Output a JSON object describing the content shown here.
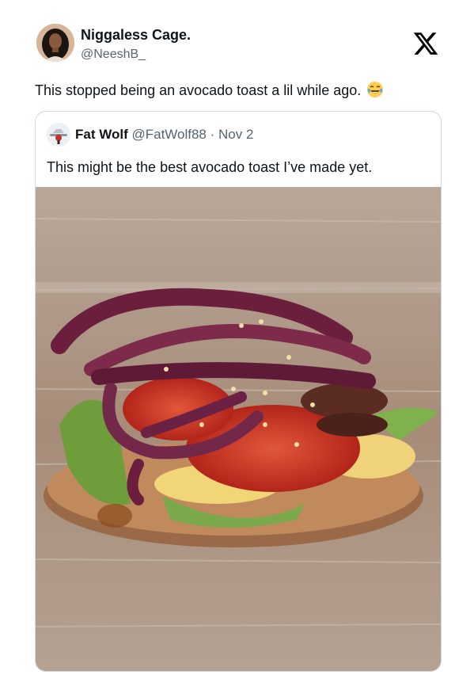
{
  "author": {
    "display_name": "Niggaless Cage.",
    "handle": "@NeeshB_",
    "avatar_icon": "profile-photo"
  },
  "platform_logo": "x-logo-icon",
  "tweet": {
    "text": "This stopped being an avocado toast a lil while ago.",
    "emoji": "face-with-tears-of-joy-emoji"
  },
  "quoted_tweet": {
    "display_name": "Fat Wolf",
    "handle": "@FatWolf88",
    "separator": "·",
    "date": "Nov 2",
    "text": "This might be the best avocado toast I’ve made yet.",
    "media": "photo of open-faced avocado toast topped with tomato, egg, mushrooms and red onion on a wooden board"
  },
  "colors": {
    "text_primary": "#0f1419",
    "text_secondary": "#536471",
    "border": "#cfd9de"
  }
}
